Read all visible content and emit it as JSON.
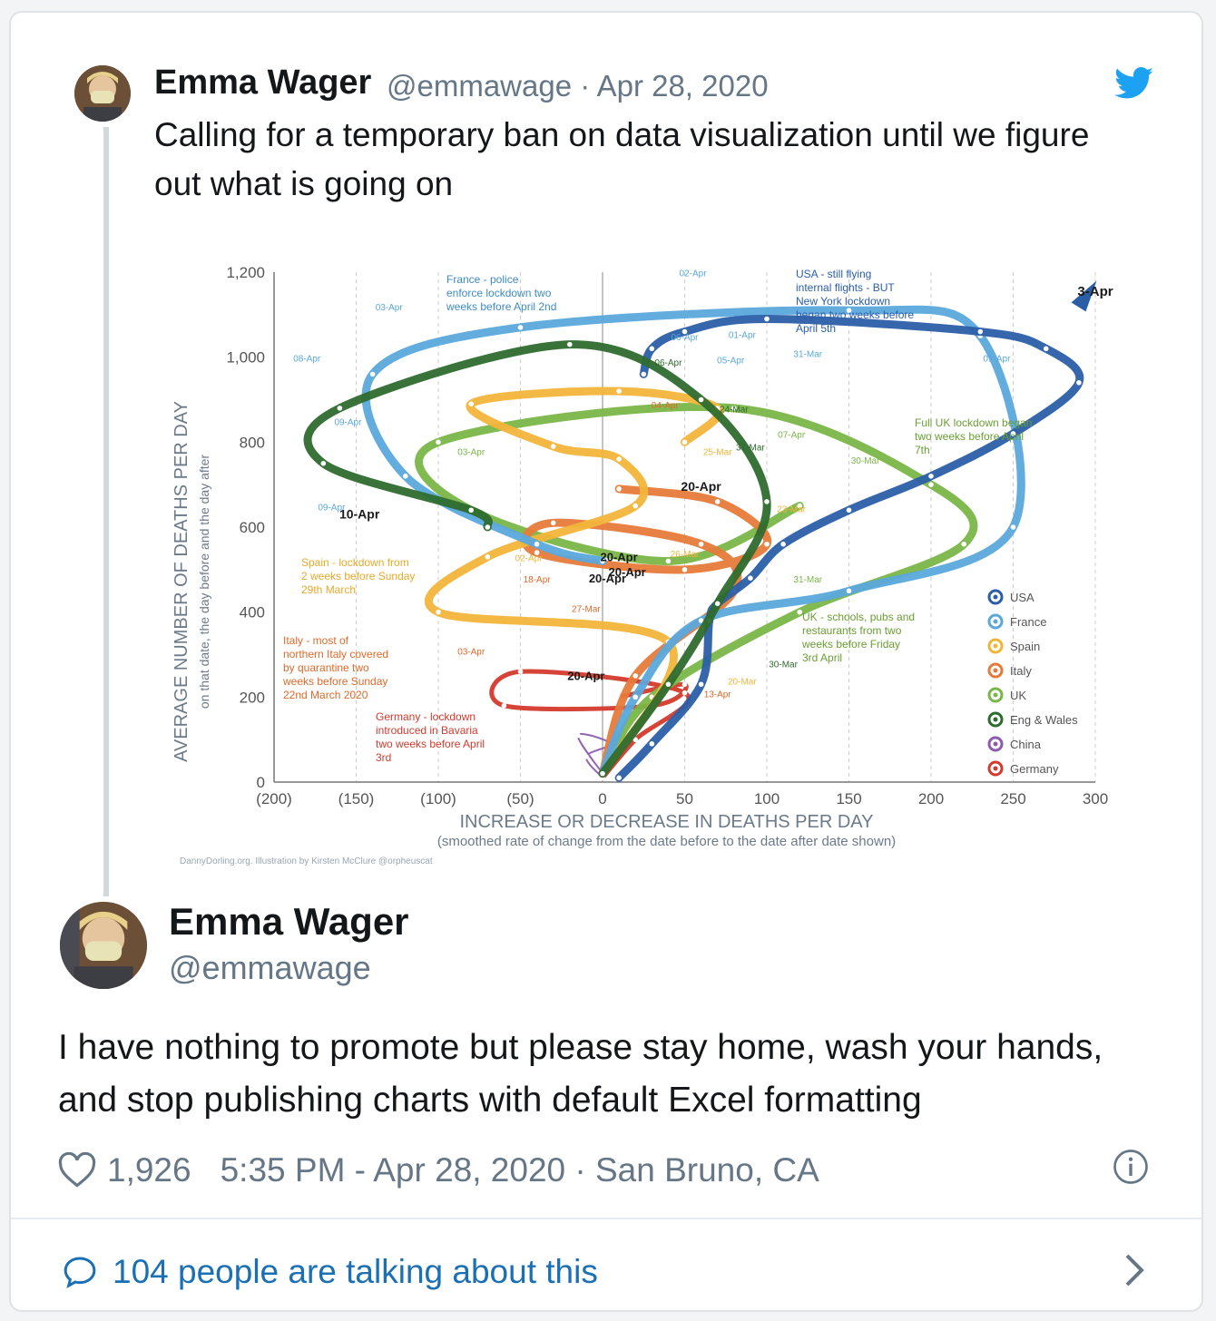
{
  "quoted_tweet": {
    "author_name": "Emma Wager",
    "handle_date": "@emmawage · Apr 28, 2020",
    "text": "Calling for a temporary ban on data visualization until we figure out what is going on",
    "icon": "twitter-bird-icon"
  },
  "chart_data": {
    "type": "line",
    "ylabel": "AVERAGE NUMBER OF DEATHS PER DAY",
    "ylabel_sub": "on that date, the day before and the day after",
    "xlabel": "INCREASE OR DECREASE IN DEATHS PER DAY",
    "xlabel_sub": "(smoothed rate of change from the date before to the date after date shown)",
    "credit": "DannyDorling.org. Illustration by Kirsten McClure @orpheuscat",
    "xlim": [
      -200,
      300
    ],
    "ylim": [
      0,
      1200
    ],
    "x_ticks": [
      "(200)",
      "(150)",
      "(100)",
      "(50)",
      "0",
      "50",
      "100",
      "150",
      "200",
      "250",
      "300"
    ],
    "y_ticks": [
      "0",
      "200",
      "400",
      "600",
      "800",
      "1,000",
      "1,200"
    ],
    "legend_position": "bottom-right",
    "series": [
      {
        "name": "USA",
        "color": "#2b5ea7",
        "x": [
          10,
          30,
          60,
          65,
          70,
          90,
          110,
          150,
          200,
          250,
          290,
          270,
          230,
          100,
          50,
          30,
          25
        ],
        "y": [
          10,
          90,
          230,
          380,
          420,
          480,
          560,
          640,
          720,
          820,
          940,
          1020,
          1060,
          1090,
          1060,
          1020,
          960
        ]
      },
      {
        "name": "France",
        "color": "#5aa8dc",
        "x": [
          0,
          20,
          60,
          150,
          250,
          230,
          150,
          -50,
          -140,
          -120,
          -40,
          0
        ],
        "y": [
          20,
          200,
          380,
          450,
          600,
          1050,
          1110,
          1070,
          960,
          720,
          560,
          520
        ]
      },
      {
        "name": "Spain",
        "color": "#f2b53a",
        "x": [
          0,
          40,
          -100,
          -70,
          20,
          10,
          -30,
          -80,
          10,
          70,
          50
        ],
        "y": [
          20,
          330,
          400,
          530,
          650,
          760,
          790,
          890,
          920,
          880,
          800
        ]
      },
      {
        "name": "Italy",
        "color": "#e77a3a",
        "x": [
          0,
          20,
          80,
          60,
          -30,
          -40,
          50,
          100,
          70,
          10
        ],
        "y": [
          20,
          250,
          450,
          560,
          610,
          540,
          500,
          560,
          660,
          690
        ]
      },
      {
        "name": "UK",
        "color": "#7ab648",
        "x": [
          0,
          30,
          120,
          220,
          200,
          80,
          -100,
          -80,
          40,
          120
        ],
        "y": [
          20,
          200,
          400,
          560,
          700,
          880,
          800,
          640,
          520,
          650
        ]
      },
      {
        "name": "Eng & Wales",
        "color": "#2e6b2e",
        "x": [
          0,
          40,
          70,
          100,
          60,
          -20,
          -160,
          -170,
          -80,
          -70
        ],
        "y": [
          20,
          230,
          420,
          660,
          900,
          1030,
          880,
          750,
          640,
          600
        ]
      },
      {
        "name": "China",
        "color": "#8e5bb0",
        "x": [
          0,
          -10,
          5,
          -15,
          0
        ],
        "y": [
          10,
          60,
          90,
          110,
          20
        ]
      },
      {
        "name": "Germany",
        "color": "#d33a2c",
        "x": [
          0,
          20,
          50,
          -50,
          -60,
          30,
          50,
          10
        ],
        "y": [
          10,
          100,
          210,
          260,
          180,
          180,
          230,
          200
        ]
      }
    ],
    "annotations": [
      "France - police enforce lockdown two weeks before April 2nd",
      "USA - still flying internal flights - BUT New York lockdown began two weeks before April 5th",
      "Full UK lockdown began two weeks before April 7th",
      "Spain - lockdown from 2 weeks before Sunday 29th March",
      "Italy - most of northern Italy covered by quarantine two weeks before Sunday 22nd March 2020",
      "UK - schools, pubs and restaurants from two weeks before Friday 3rd April",
      "Germany - lockdown introduced in Bavaria two weeks before April 3rd"
    ],
    "date_labels": [
      "3-Apr",
      "10-Apr",
      "20-Apr",
      "20-Apr",
      "20-Apr",
      "20-Apr",
      "20-Apr",
      "02-Apr",
      "03-Apr",
      "06-Apr",
      "01-Apr",
      "31-Mar",
      "05-Apr",
      "08-Apr",
      "09-Apr",
      "09-Apr",
      "07-Apr",
      "30-Mar",
      "31-Mar",
      "01-Apr",
      "23-Mar",
      "26-Mar",
      "18-Apr",
      "27-Mar",
      "03-Apr",
      "20-Mar",
      "13-Apr",
      "30-Mar",
      "31-Mar",
      "24-Mar",
      "25-Mar",
      "02-Apr",
      "03-Apr",
      "06-Apr",
      "04-Apr"
    ]
  },
  "main_tweet": {
    "author_name": "Emma Wager",
    "handle": "@emmawage",
    "text": "I have nothing to promote but please stay home, wash your hands, and stop publishing charts with default Excel formatting",
    "likes": "1,926",
    "timestamp": "5:35 PM - Apr 28, 2020 · San Bruno, CA",
    "talking": "104 people are talking about this"
  },
  "icons": {
    "like": "heart-icon",
    "info": "info-icon",
    "reply": "speech-bubble-icon",
    "chevron": "chevron-right-icon"
  }
}
